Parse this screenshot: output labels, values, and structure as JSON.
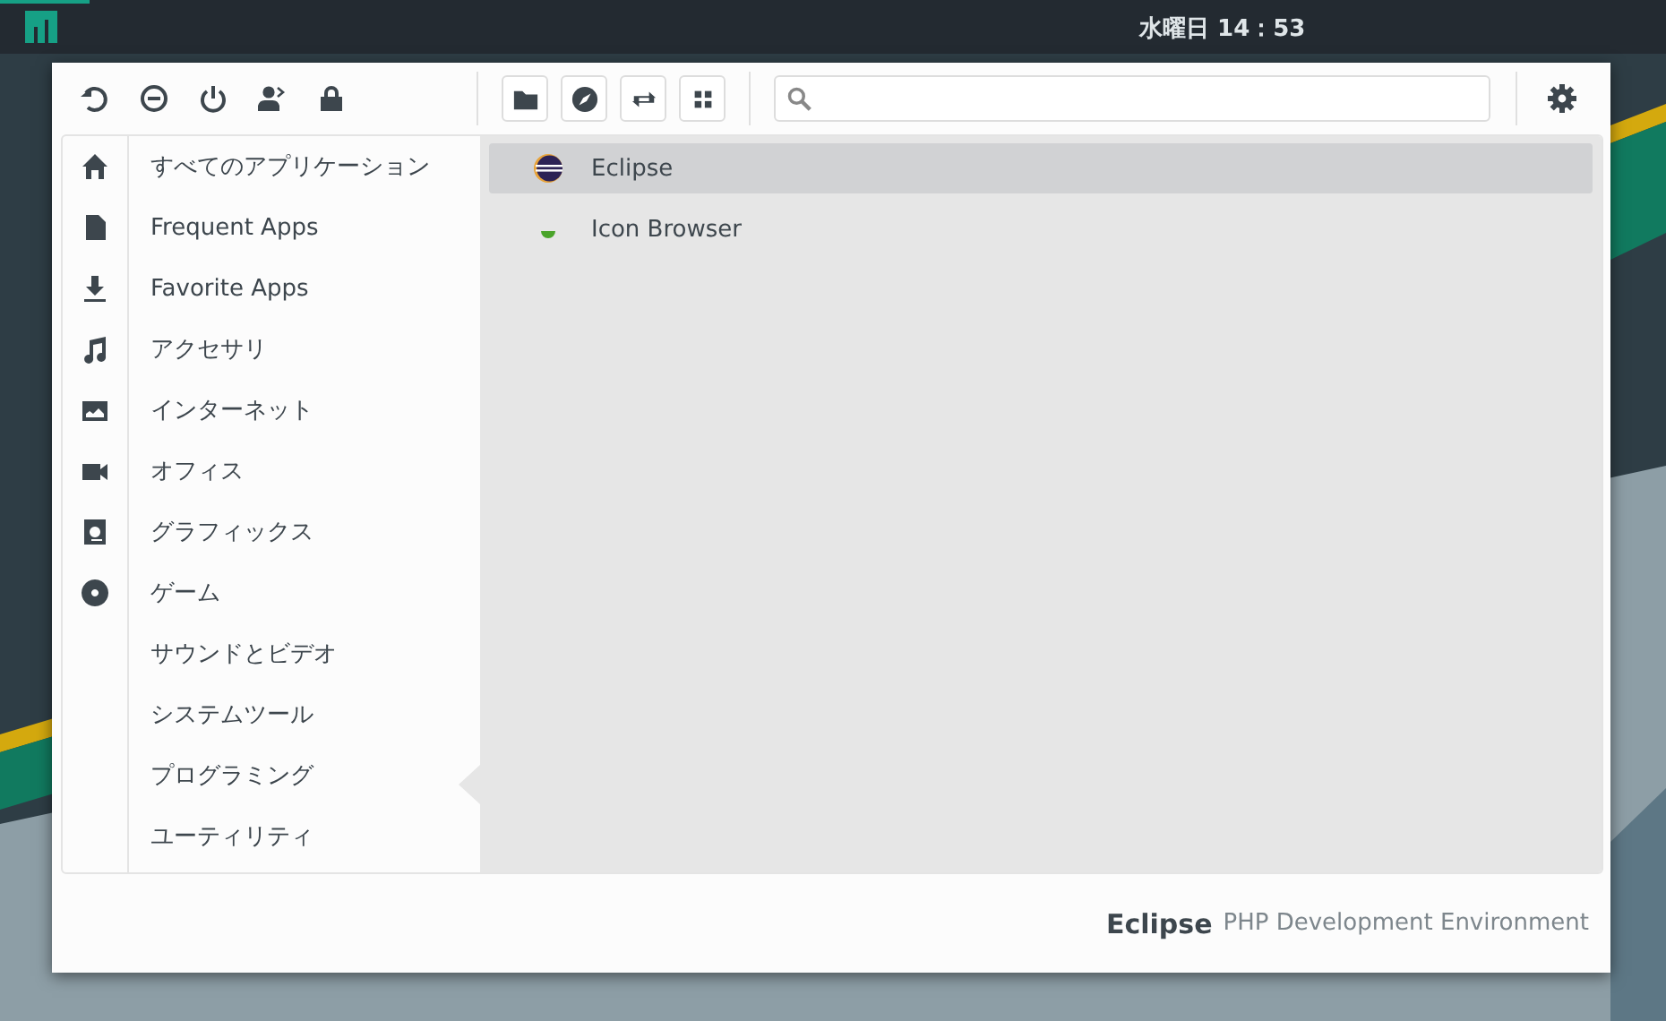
{
  "top_panel": {
    "clock": "水曜日 14：53"
  },
  "categories": [
    {
      "label": "すべてのアプリケーション",
      "selected": false
    },
    {
      "label": "Frequent Apps",
      "selected": false
    },
    {
      "label": "Favorite Apps",
      "selected": false
    },
    {
      "label": "アクセサリ",
      "selected": false
    },
    {
      "label": "インターネット",
      "selected": false
    },
    {
      "label": "オフィス",
      "selected": false
    },
    {
      "label": "グラフィックス",
      "selected": false
    },
    {
      "label": "ゲーム",
      "selected": false
    },
    {
      "label": "サウンドとビデオ",
      "selected": false
    },
    {
      "label": "システムツール",
      "selected": false
    },
    {
      "label": "プログラミング",
      "selected": true
    },
    {
      "label": "ユーティリティ",
      "selected": false
    }
  ],
  "apps": [
    {
      "name": "Eclipse",
      "selected": true
    },
    {
      "name": "Icon Browser",
      "selected": false
    }
  ],
  "footer": {
    "app_name": "Eclipse",
    "description": "PHP Development Environment"
  }
}
